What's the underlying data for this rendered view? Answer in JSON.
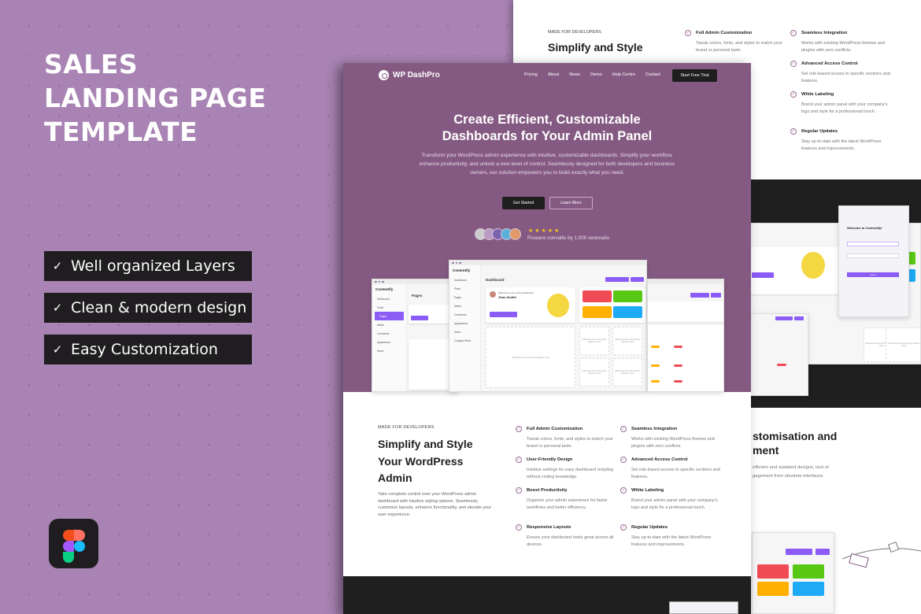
{
  "promo": {
    "title_lines": [
      "SALES",
      "LANDING PAGE",
      "TEMPLATE"
    ],
    "features": [
      "Well organized Layers",
      "Clean & modern design",
      "Easy Customization"
    ],
    "tool_badge": "figma-logo"
  },
  "site": {
    "brand": "WP DashPro",
    "nav": [
      "Pricing",
      "About",
      "News",
      "Demo",
      "Help Centre",
      "Contact"
    ],
    "cta": "Start Free Trial",
    "hero": {
      "title_line1": "Create Efficient, Customizable",
      "title_line2": "Dashboards for Your Admin Panel",
      "description": "Transform your WordPress admin experience with intuitive, customizable dashboards. Simplify your workflow, enhance productivity, and unlock a new level of control. Seamlessly designed for both developers and business owners, our solution empowers you to build exactly what you need.",
      "primary_button": "Get Started",
      "secondary_button": "Learn More",
      "rating_stars": 5,
      "rating_text": "Posuere convallis by 1,000 venenatis"
    },
    "mockup": {
      "app_name": "Contentify",
      "dashboard_title": "Dashboard",
      "pages_title": "Pages",
      "welcome": "Welcome to your custom dashboard",
      "user": "Jhon Smith!",
      "sidebar": [
        "Dashboard",
        "Posts",
        "Pages",
        "Media",
        "Comments",
        "Appearance",
        "Users",
        "Collapse Menu"
      ],
      "screen_options": "Screen Options",
      "help": "Help",
      "tile_colors": [
        "#f04b55",
        "#58c814",
        "#ffb000",
        "#1eaaf5"
      ],
      "empty_box": "Add boxes from the Screen Options menu",
      "login_title": "Welcome to Contentify!",
      "login_button": "Log in"
    },
    "developers": {
      "label": "MADE FOR DEVELOPERS",
      "title": "Simplify and Style Your WordPress Admin",
      "description": "Take complete control over your WordPress admin dashboard with intuitive styling options. Seamlessly customize layouts, enhance functionality, and elevate your user experience.",
      "features": [
        {
          "title": "Full Admin Customization",
          "text": "Tweak colors, fonts, and styles to match your brand or personal taste."
        },
        {
          "title": "Seamless Integration",
          "text": "Works with existing WordPress themes and plugins with zero conflicts."
        },
        {
          "title": "User-Friendly Design",
          "text": "Intuitive settings for easy dashboard restyling without coding knowledge."
        },
        {
          "title": "Advanced Access Control",
          "text": "Set role-based access to specific sections and features."
        },
        {
          "title": "Boost Productivity",
          "text": "Organize your admin experience for faster workflows and better efficiency."
        },
        {
          "title": "White Labeling",
          "text": "Brand your admin panel with your company's logo and style for a professional touch."
        },
        {
          "title": "Responsive Layouts",
          "text": "Ensure your dashboard looks great across all devices."
        },
        {
          "title": "Regular Updates",
          "text": "Stay up-to-date with the latest WordPress features and improvements."
        }
      ]
    },
    "back_section": {
      "title_line1": "stomisation and",
      "title_line2": "ment",
      "text_line1": "efficient and outdated designs, lack of",
      "text_line2": "gagement from obsolete interfaces."
    }
  },
  "colors": {
    "promo_bg": "#a883b3",
    "hero_bg": "#855a82",
    "dark": "#1f1f1f",
    "accent": "#8b5cf6"
  }
}
